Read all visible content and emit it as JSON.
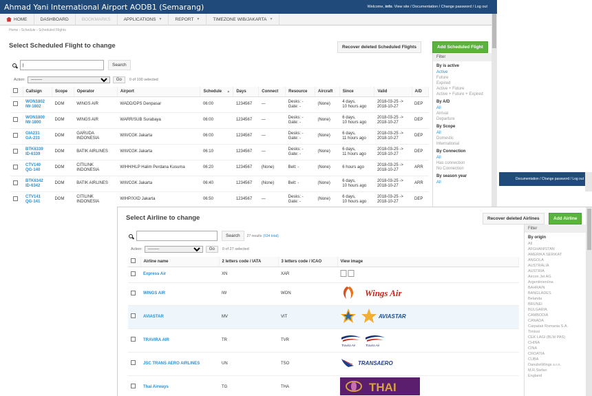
{
  "app": {
    "title": "Ahmad Yani International Airport AODB1 (Semarang)",
    "welcome": "Welcome,",
    "user": "info",
    "user_links": "View site / Documentation / Change password / Log out"
  },
  "nav": {
    "items": [
      {
        "label": "HOME"
      },
      {
        "label": "DASHBOARD"
      },
      {
        "label": "BOOKMARKS"
      },
      {
        "label": "APPLICATIONS"
      },
      {
        "label": "REPORT"
      },
      {
        "label": "TIMEZONE WIB/JAKARTA"
      }
    ]
  },
  "breadcrumb": "Home › Schedule › Scheduled Flights",
  "flights": {
    "title": "Select Scheduled Flight to change",
    "recover_label": "Recover deleted Scheduled Flights",
    "add_label": "Add Scheduled Flight",
    "search_button": "Search",
    "action_label": "Action:",
    "action_value": "---------",
    "go_label": "Go",
    "selected_count": "0 of 100 selected",
    "columns": [
      "Callsign",
      "Scope",
      "Operator",
      "Airport",
      "Schedule",
      "Days",
      "Connect",
      "Resource",
      "Aircraft",
      "Since",
      "Valid",
      "A/D"
    ],
    "rows": [
      {
        "callsign": "WON1802",
        "callsign2": "IW-1802",
        "scope": "DOM",
        "operator": "WINGS AIR",
        "operator2": "",
        "airport": "WADD/DPS Denpasar",
        "schedule": "06:00",
        "days": "1234567",
        "connect": "—",
        "res1": "Desks: -",
        "res2": "Gate: -",
        "aircraft": "(None)",
        "since1": "4 days,",
        "since2": "10 hours ago",
        "valid1": "2018-03-25 ->",
        "valid2": "2018-10-27",
        "ad": "DEP"
      },
      {
        "callsign": "WON1800",
        "callsign2": "IW-1800",
        "scope": "DOM",
        "operator": "WINGS AIR",
        "operator2": "",
        "airport": "WARR/SUB Surabaya",
        "schedule": "06:00",
        "days": "1234567",
        "connect": "—",
        "res1": "Desks: -",
        "res2": "Gate: -",
        "aircraft": "(None)",
        "since1": "6 days,",
        "since2": "10 hours ago",
        "valid1": "2018-03-25 ->",
        "valid2": "2018-10-27",
        "ad": "DEP"
      },
      {
        "callsign": "GIA231",
        "callsign2": "GA-231",
        "scope": "DOM",
        "operator": "GARUDA",
        "operator2": "INDONESIA",
        "airport": "WIII/CGK Jakarta",
        "schedule": "06:00",
        "days": "1234567",
        "connect": "—",
        "res1": "Desks: -",
        "res2": "Gate: -",
        "aircraft": "(None)",
        "since1": "6 days,",
        "since2": "11 hours ago",
        "valid1": "2018-03-25 ->",
        "valid2": "2018-10-27",
        "ad": "DEP"
      },
      {
        "callsign": "BTK6339",
        "callsign2": "ID-6339",
        "scope": "DOM",
        "operator": "BATIK AIRLINES",
        "operator2": "",
        "airport": "WIII/CGK Jakarta",
        "schedule": "06:10",
        "days": "1234567",
        "connect": "—",
        "res1": "Desks: -",
        "res2": "Gate: -",
        "aircraft": "(None)",
        "since1": "6 days,",
        "since2": "11 hours ago",
        "valid1": "2018-03-25 ->",
        "valid2": "2018-10-27",
        "ad": "DEP"
      },
      {
        "callsign": "CTV140",
        "callsign2": "QG-140",
        "scope": "DOM",
        "operator": "CITILINK",
        "operator2": "INDONESIA",
        "airport": "WIHH/HLP Halim Perdana Kusuma",
        "schedule": "06:20",
        "days": "1234567",
        "connect": "(None)",
        "res1": "Belt: -",
        "res2": "",
        "aircraft": "(None)",
        "since1": "6 hours ago",
        "since2": "",
        "valid1": "2018-03-25 ->",
        "valid2": "2018-10-27",
        "ad": "ARR"
      },
      {
        "callsign": "BTK6342",
        "callsign2": "ID-6342",
        "scope": "DOM",
        "operator": "BATIK AIRLINES",
        "operator2": "",
        "airport": "WIII/CGK Jakarta",
        "schedule": "06:40",
        "days": "1234567",
        "connect": "(None)",
        "res1": "Belt: -",
        "res2": "",
        "aircraft": "(None)",
        "since1": "6 days,",
        "since2": "10 hours ago",
        "valid1": "2018-03-25 ->",
        "valid2": "2018-10-27",
        "ad": "ARR"
      },
      {
        "callsign": "CTV141",
        "callsign2": "QG-141",
        "scope": "DOM",
        "operator": "CITILINK",
        "operator2": "INDONESIA",
        "airport": "WIHP/XXD Jakarta",
        "schedule": "06:50",
        "days": "1234567",
        "connect": "—",
        "res1": "Desks: -",
        "res2": "Gate: -",
        "aircraft": "(None)",
        "since1": "6 days,",
        "since2": "10 hours ago",
        "valid1": "2018-03-25 ->",
        "valid2": "2018-10-27",
        "ad": "DEP"
      }
    ]
  },
  "flight_filter": {
    "title": "Filter",
    "groups": [
      {
        "heading": "By is active",
        "options": [
          "Active",
          "Future",
          "Expired",
          "Active + Future",
          "Active + Future + Expired"
        ],
        "selected": 0
      },
      {
        "heading": "By A/D",
        "options": [
          "All",
          "Arrival",
          "Departure"
        ],
        "selected": 0
      },
      {
        "heading": "By Scope",
        "options": [
          "All",
          "Domestic",
          "International"
        ],
        "selected": 0
      },
      {
        "heading": "By Connection",
        "options": [
          "All",
          "Has connection",
          "No Connection"
        ],
        "selected": 0
      },
      {
        "heading": "By season year",
        "options": [
          "All"
        ],
        "selected": 0
      }
    ]
  },
  "win3": {
    "links": "Documentation / Change password / Log out"
  },
  "airlines": {
    "title": "Select Airline to change",
    "recover_label": "Recover deleted Airlines",
    "add_label": "Add Airline",
    "search_button": "Search",
    "results": "27 results",
    "results_total": "(634 total)",
    "action_label": "Action:",
    "action_value": "---------",
    "go_label": "Go",
    "selected_count": "0 of 27 selected",
    "columns": [
      "Airline name",
      "2 letters code / IATA",
      "3 letters code / ICAO",
      "View image"
    ],
    "rows": [
      {
        "name": "Express Air",
        "iata": "XN",
        "icao": "XAR",
        "logo": "doc-icons"
      },
      {
        "name": "WINGS AIR",
        "iata": "IW",
        "icao": "WON",
        "logo": "wings-air",
        "logo_text": "Wings Air"
      },
      {
        "name": "AVIASTAR",
        "iata": "MV",
        "icao": "VIT",
        "logo": "aviastar",
        "logo_text": "AVIASTAR"
      },
      {
        "name": "TRAVIRA AIR",
        "iata": "TR",
        "icao": "TVR",
        "logo": "travira",
        "logo_text": "Travira Air"
      },
      {
        "name": "JSC TRANS AERO AIRLINES",
        "iata": "UN",
        "icao": "TSO",
        "logo": "transaero",
        "logo_text": "TRANSAERO"
      },
      {
        "name": "Thai Airways",
        "iata": "TG",
        "icao": "THA",
        "logo": "thai",
        "logo_text": "THAI"
      }
    ]
  },
  "airline_filter": {
    "title": "Filter",
    "heading": "By origin",
    "options": [
      "All",
      "AFGHANISTAN",
      "AMERIKA SERIKAT",
      "ANGOLA",
      "AUSTRALIA",
      "AUSTRIA",
      "Aircon Jet AG",
      "Argentinien/ina",
      "BAHRAIN",
      "BANGLADES",
      "Belanda",
      "BRUNEI",
      "BULGARIA",
      "CAMBODIA",
      "CANADA",
      "Carpatair Romania S.A.",
      "Timisoi",
      "CEK LAGI (BLM PAS)",
      "CHINA",
      "CINA",
      "CROATIA",
      "CUBA",
      "DanubeWings s.r.o.",
      "M.R.Stefan",
      "England"
    ]
  },
  "colors": {
    "header": "#1f4a7a",
    "accent_green": "#5cb23f",
    "link": "#2d8fcf"
  }
}
